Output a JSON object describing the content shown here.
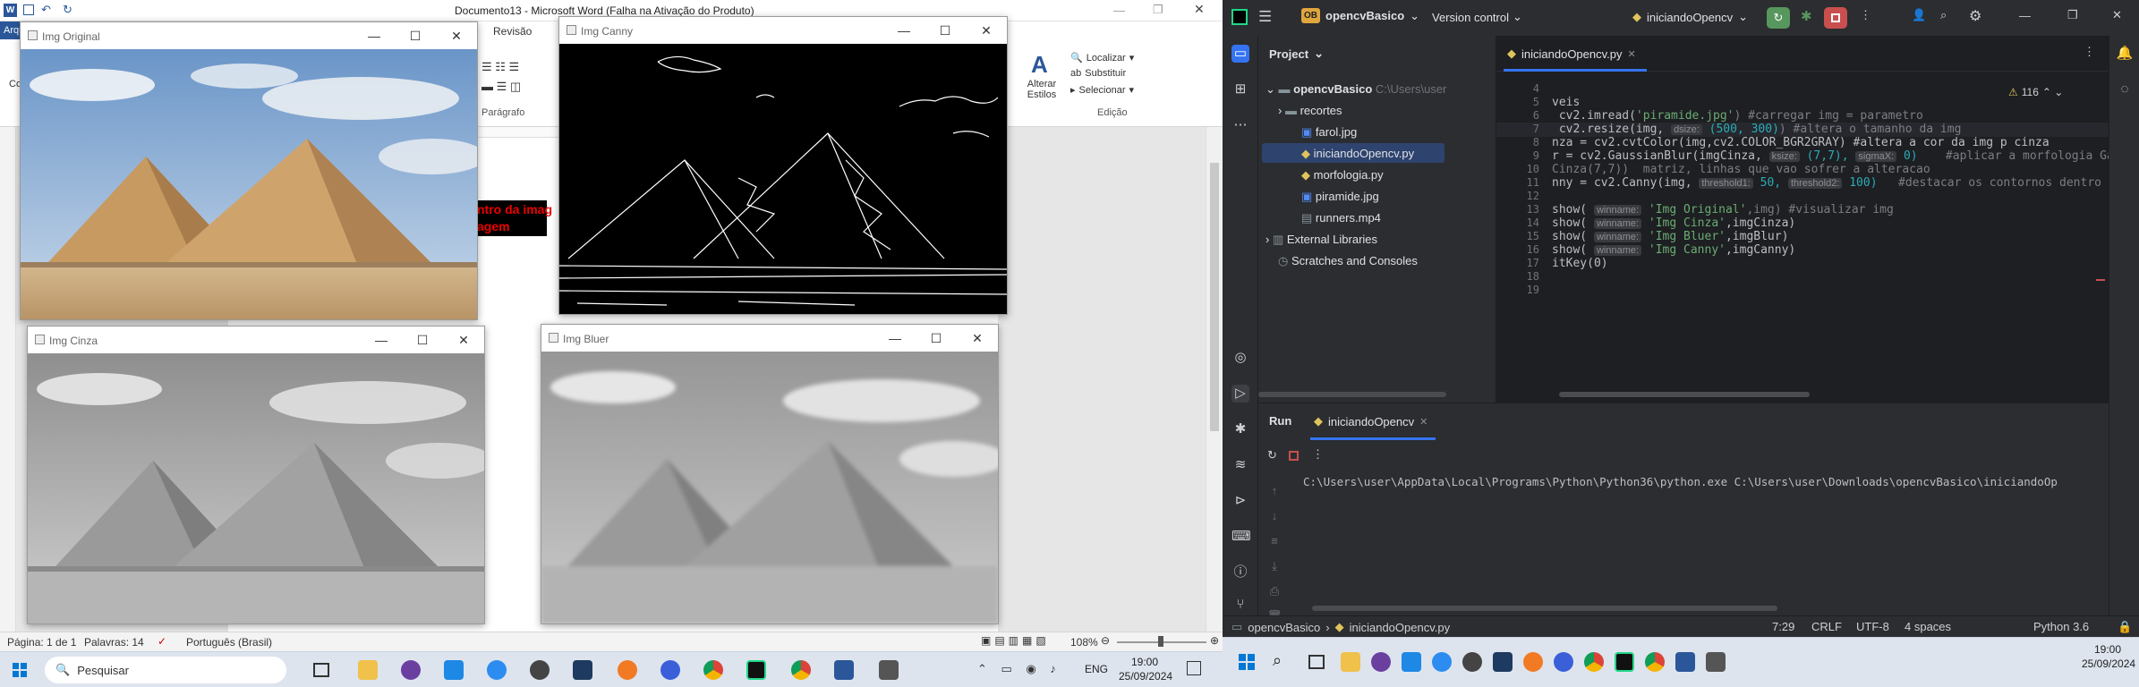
{
  "word": {
    "title": "Documento13 - Microsoft Word (Falha na Ativação do Produto)",
    "tab_file": "Arqu",
    "tab_review": "Revisão",
    "paragraph_group": "Parágrafo",
    "edit_group": "Edição",
    "find": "Localizar",
    "replace": "Substituir",
    "select": "Selecionar",
    "styles_button": "Alterar Estilos",
    "paste_partial": "Cola",
    "page_text_1": "ntro da imag",
    "page_text_2": "agem",
    "status_page": "Página: 1 de 1",
    "status_words": "Palavras: 14",
    "status_lang": "Português (Brasil)",
    "zoom": "108%"
  },
  "cv_windows": {
    "original": "Img Original",
    "canny": "Img Canny",
    "cinza": "Img Cinza",
    "bluer": "Img Bluer"
  },
  "taskbar_left": {
    "search": "Pesquisar",
    "lang": "ENG",
    "time": "19:00",
    "date": "25/09/2024"
  },
  "pycharm": {
    "project_badge": "OB",
    "project_name": "opencvBasico",
    "vcs": "Version control",
    "run_config": "iniciandoOpencv",
    "project_label": "Project",
    "tree": {
      "root": "opencvBasico",
      "root_path": "C:\\Users\\user",
      "recortes": "recortes",
      "f1": "farol.jpg",
      "f2": "iniciandoOpencv.py",
      "f3": "morfologia.py",
      "f4": "piramide.jpg",
      "f5": "runners.mp4",
      "ext": "External Libraries",
      "scratch": "Scratches and Consoles"
    },
    "editor_tab": "iniciandoOpencv.py",
    "warnings": "116",
    "lines": [
      "4",
      "5",
      "6",
      "7",
      "8",
      "9",
      "10",
      "11",
      "12",
      "13",
      "14",
      "15",
      "16",
      "17",
      "18",
      "19"
    ],
    "code": {
      "l5": "veis",
      "l6a": " cv2.imread(",
      "l6s": "'piramide.jpg'",
      "l6c": ") #carregar img = parametro",
      "l7a": " cv2.resize(img, ",
      "l7h": "dsize:",
      "l7n": " (500, 300)",
      "l7c": ") #altera o tamanho da img",
      "l8a": "nza = cv2.cvtColor(img,cv2.COLOR_BGR2GRAY) #altera a cor da img p cinza",
      "l9a": "r = cv2.GaussianBlur(imgCinza, ",
      "l9h1": "ksize:",
      "l9n1": " (7,7), ",
      "l9h2": "sigmaX:",
      "l9n2": " 0)",
      "l9c": "    #aplicar a morfologia Ga",
      "l10": "Cinza(7,7))  matriz, linhas que vao sofrer a alteracao",
      "l11a": "nny = cv2.Canny(img, ",
      "l11h1": "threshold1:",
      "l11n1": " 50, ",
      "l11h2": "threshold2:",
      "l11n2": " 100)",
      "l11c": "   #destacar os contornos dentro d",
      "l13a": "show( ",
      "l13h": "winname:",
      "l13s": " 'Img Original'",
      "l13c": ",img) #visualizar img",
      "l14s": " 'Img Cinza'",
      "l14c": ",imgCinza)",
      "l15s": " 'Img Bluer'",
      "l15c": ",imgBlur)",
      "l16s": " 'Img Canny'",
      "l16c": ",imgCanny)",
      "l17": "itKey(0)"
    },
    "run_label": "Run",
    "run_tab": "iniciandoOpencv",
    "console": "C:\\Users\\user\\AppData\\Local\\Programs\\Python\\Python36\\python.exe C:\\Users\\user\\Downloads\\opencvBasico\\iniciandoOp",
    "status": {
      "crumb1": "opencvBasico",
      "crumb2": "iniciandoOpencv.py",
      "pos": "7:29",
      "eol": "CRLF",
      "enc": "UTF-8",
      "indent": "4 spaces",
      "interp": "Python 3.6"
    }
  },
  "taskbar_right": {
    "time": "19:00",
    "date": "25/09/2024"
  },
  "colors": {
    "pycharm_bg": "#1e1f22",
    "pycharm_panel": "#2b2d30",
    "accent_red": "#c94f4f",
    "accent_green": "#57965c",
    "word_blue": "#2b579a"
  }
}
